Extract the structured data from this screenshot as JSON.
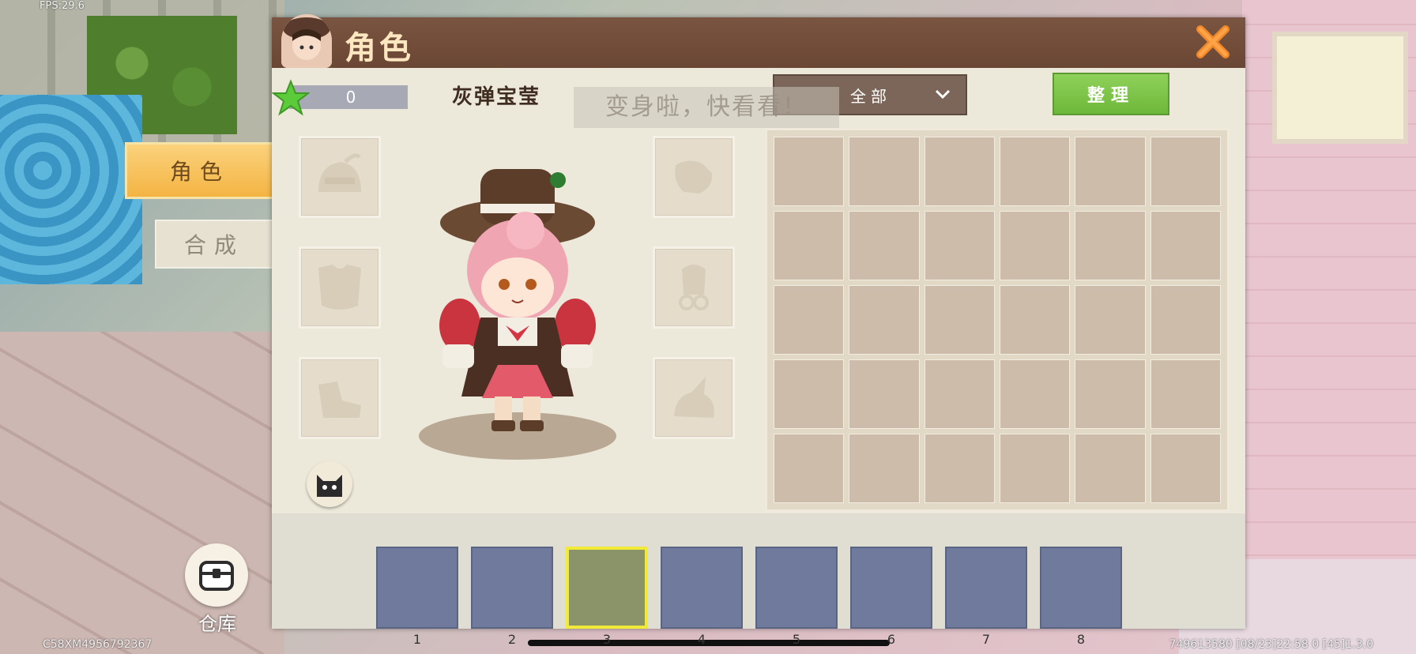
{
  "hud": {
    "fps": "FPS:29.6",
    "device_id": "C58XM4956792367",
    "device_info": "749613580   [08/23]22:58 0   [45]1.3.0"
  },
  "side_tabs": {
    "character": "角色",
    "crafting": "合成"
  },
  "storage": {
    "label": "仓库",
    "icon": "chest-icon"
  },
  "panel": {
    "title": "角色",
    "close_icon": "close-x-icon",
    "star_value": "0",
    "character_name": "灰弹宝莹",
    "toast": "变身啦，快看看！",
    "filter": {
      "selected": "全部"
    },
    "sort_button": "整理",
    "equip_slots_left": [
      "helmet-slot-icon",
      "chestplate-slot-icon",
      "boots-slot-icon"
    ],
    "equip_slots_right": [
      "gloves-slot-icon",
      "accessory-slot-icon",
      "pet-slot-icon"
    ],
    "bag": {
      "columns": 6,
      "rows": 5
    },
    "hotbar": [
      "1",
      "2",
      "3",
      "4",
      "5",
      "6",
      "7",
      "8"
    ],
    "hotbar_selected_index": 2
  },
  "colors": {
    "title_bar": "#6f4b39",
    "active_tab": "#f4b443",
    "sort_button": "#7ac447",
    "hotbar_slot": "#6f7a9c",
    "hotbar_selected": "#f2ea38"
  }
}
